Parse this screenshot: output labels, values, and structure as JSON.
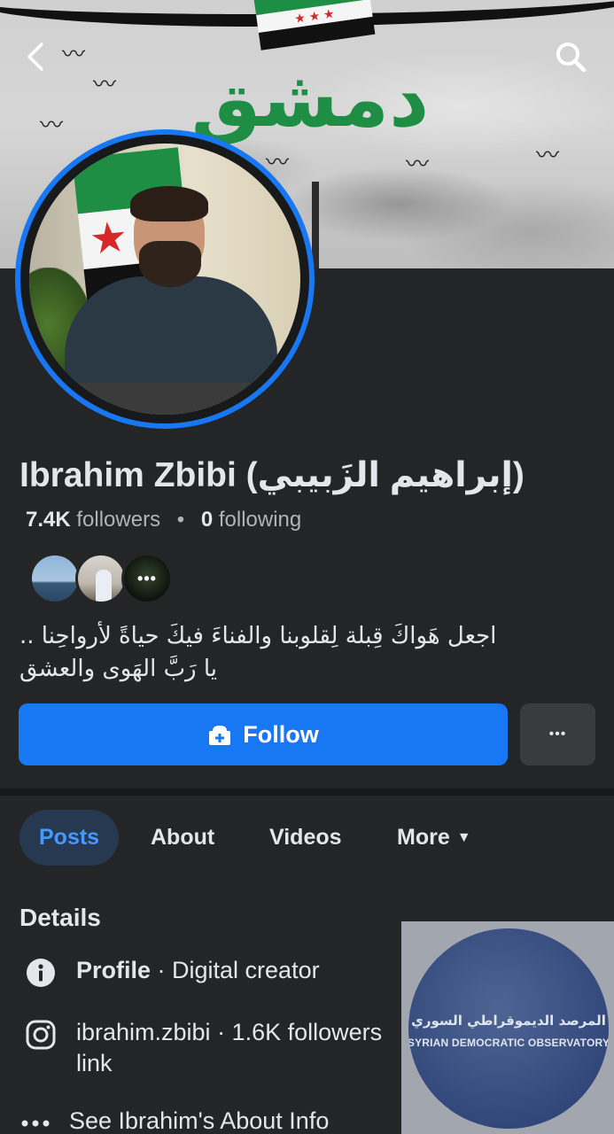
{
  "profile": {
    "name": "Ibrahim Zbibi (إبراهيم الزَبيبي)",
    "followers_count": "7.4K",
    "followers_label": "followers",
    "separator": "•",
    "following_count": "0",
    "following_label": "following",
    "bio_line1": "اجعل هَواكَ قِبلة لِقلوبنا والفناءَ فيكَ حياةً لأرواحِنا ..",
    "bio_line2": "يا رَبَّ الهَوى والعشق"
  },
  "cover": {
    "city_text": "دمشق"
  },
  "mutual_more": "•••",
  "actions": {
    "follow_label": "Follow",
    "more_label": "•••"
  },
  "tabs": [
    {
      "label": "Posts",
      "active": true
    },
    {
      "label": "About",
      "active": false
    },
    {
      "label": "Videos",
      "active": false
    },
    {
      "label": "More",
      "active": false
    }
  ],
  "details": {
    "title": "Details",
    "profile_key": "Profile",
    "profile_value": " · Digital creator",
    "instagram_handle": "ibrahim.zbibi",
    "instagram_stats": " · 1.6K followers",
    "instagram_suffix": "link",
    "about_info": "See Ibrahim's About Info"
  },
  "watermark": {
    "arabic": "المرصد الديموقراطي السوري",
    "english": "SYRIAN DEMOCRATIC OBSERVATORY"
  },
  "colors": {
    "background": "#242526",
    "accent": "#1877f2",
    "active_tab_bg": "#263951",
    "active_tab_text": "#4599ff"
  },
  "icons": {
    "back": "chevron-left-icon",
    "search": "search-icon",
    "follow": "add-friend-icon",
    "info": "info-icon",
    "instagram": "instagram-icon",
    "more": "ellipsis-icon"
  }
}
